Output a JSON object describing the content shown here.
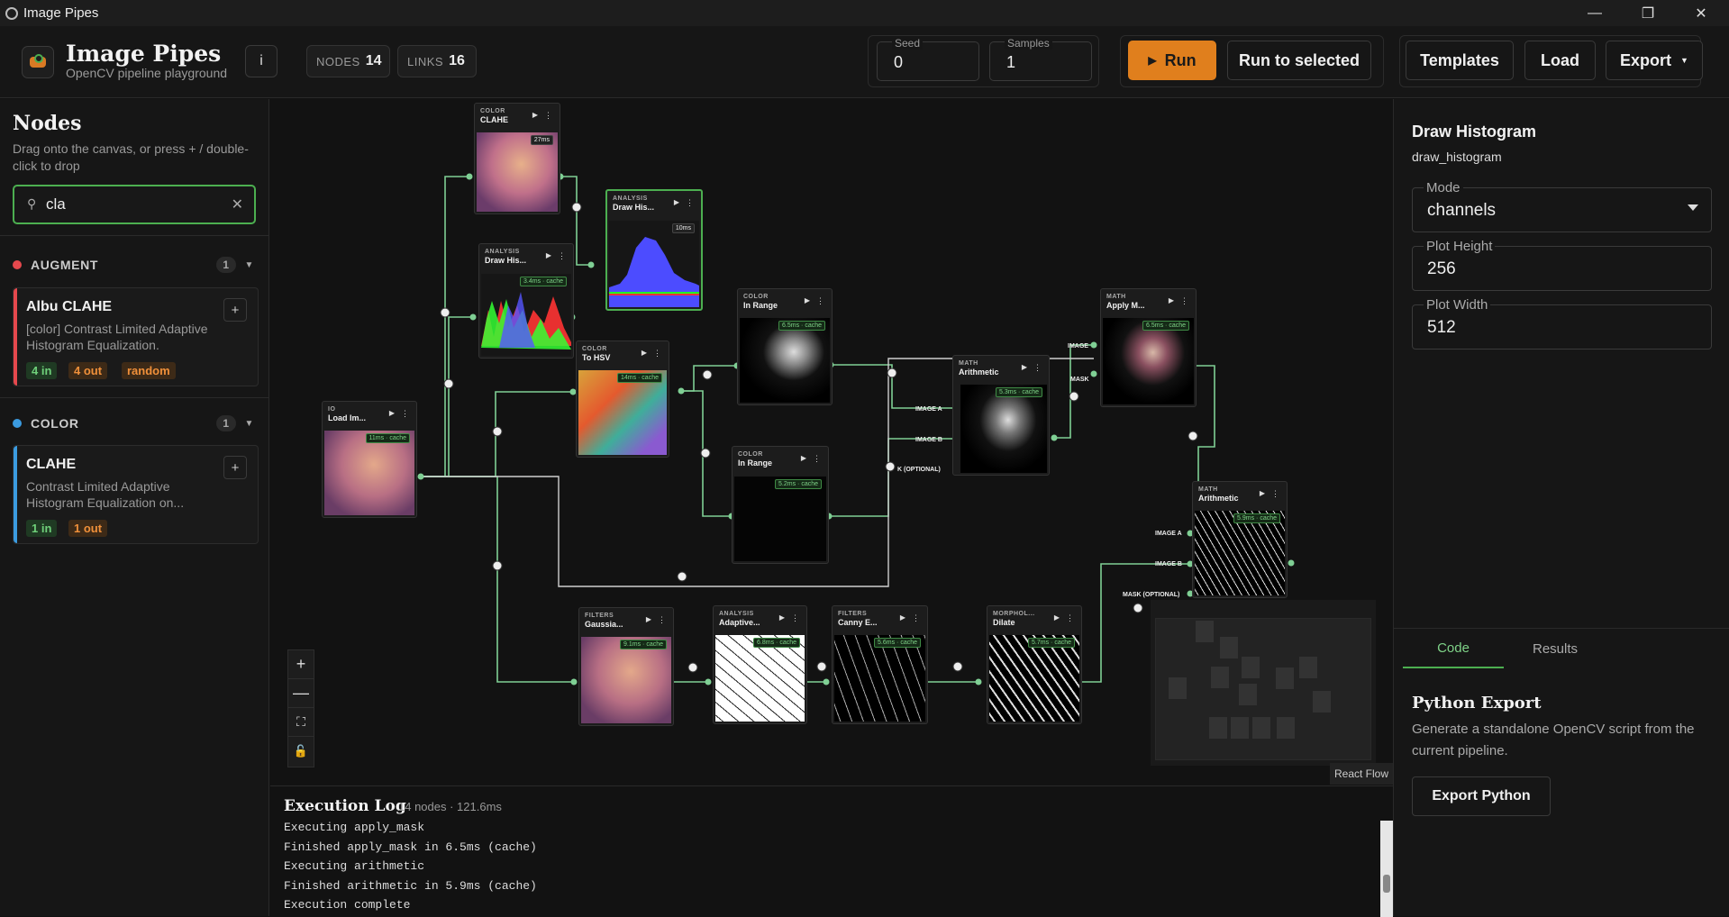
{
  "window": {
    "title": "Image Pipes",
    "min_icon": "minimize-icon",
    "max_icon": "maximize-icon",
    "close_icon": "close-icon"
  },
  "header": {
    "title": "Image Pipes",
    "subtitle": "OpenCV pipeline playground",
    "info_label": "i",
    "nodes_label": "NODES",
    "nodes_count": "14",
    "links_label": "LINKS",
    "links_count": "16",
    "seed_label": "Seed",
    "seed_value": "0",
    "samples_label": "Samples",
    "samples_value": "1",
    "run_label": "Run",
    "run_selected_label": "Run to selected",
    "templates_label": "Templates",
    "load_label": "Load",
    "export_label": "Export"
  },
  "sidebar": {
    "title": "Nodes",
    "hint": "Drag onto the canvas, or press + / double-click to drop",
    "search_value": "cla",
    "categories": [
      {
        "name": "AUGMENT",
        "count": "1",
        "color": "#e5484d",
        "item": {
          "title": "Albu CLAHE",
          "desc": "[color] Contrast Limited Adaptive Histogram Equalization.",
          "tags": [
            "4 in",
            "4 out",
            "random"
          ]
        }
      },
      {
        "name": "COLOR",
        "count": "1",
        "color": "#3b9be0",
        "item": {
          "title": "CLAHE",
          "desc": "Contrast Limited Adaptive Histogram Equalization on...",
          "tags": [
            "1 in",
            "1 out"
          ]
        }
      }
    ]
  },
  "nodes": {
    "clahe": {
      "cat": "COLOR",
      "name": "CLAHE",
      "badge": "27ms"
    },
    "drawhist1": {
      "cat": "ANALYSIS",
      "name": "Draw His...",
      "badge": "10ms"
    },
    "drawhist2": {
      "cat": "ANALYSIS",
      "name": "Draw His...",
      "badge": "3.4ms · cache"
    },
    "tohsv": {
      "cat": "COLOR",
      "name": "To HSV",
      "badge": "14ms · cache"
    },
    "inrange1": {
      "cat": "COLOR",
      "name": "In Range",
      "badge": "6.5ms · cache"
    },
    "inrange2": {
      "cat": "COLOR",
      "name": "In Range",
      "badge": "5.2ms · cache"
    },
    "loadimg": {
      "cat": "IO",
      "name": "Load Im...",
      "badge": "11ms · cache"
    },
    "arith1": {
      "cat": "MATH",
      "name": "Arithmetic",
      "badge": "5.3ms · cache"
    },
    "applymask": {
      "cat": "MATH",
      "name": "Apply M...",
      "badge": "6.5ms · cache"
    },
    "arith2": {
      "cat": "MATH",
      "name": "Arithmetic",
      "badge": "5.9ms · cache"
    },
    "gauss": {
      "cat": "FILTERS",
      "name": "Gaussia...",
      "badge": "9.1ms · cache"
    },
    "adaptive": {
      "cat": "ANALYSIS",
      "name": "Adaptive...",
      "badge": "6.8ms · cache"
    },
    "canny": {
      "cat": "FILTERS",
      "name": "Canny E...",
      "badge": "5.6ms · cache"
    },
    "dilate": {
      "cat": "MORPHOL...",
      "name": "Dilate",
      "badge": "5.7ms · cache"
    }
  },
  "ports": {
    "image": "IMAGE",
    "mask": "MASK",
    "image_a": "IMAGE A",
    "image_b": "IMAGE B",
    "mask_optional": "MASK (OPTIONAL)",
    "k_optional": "K (OPTIONAL)"
  },
  "canvas": {
    "attribution": "React Flow"
  },
  "log": {
    "title": "Execution Log",
    "meta": "14 nodes · 121.6ms",
    "lines": [
      "Executing apply_mask",
      "Finished apply_mask in 6.5ms (cache)",
      "Executing arithmetic",
      "Finished arithmetic in 5.9ms (cache)",
      "Execution complete"
    ]
  },
  "inspector": {
    "title": "Draw Histogram",
    "key": "draw_histogram",
    "mode_label": "Mode",
    "mode_value": "channels",
    "height_label": "Plot Height",
    "height_value": "256",
    "width_label": "Plot Width",
    "width_value": "512",
    "tab_code": "Code",
    "tab_results": "Results",
    "export_title": "Python Export",
    "export_desc": "Generate a standalone OpenCV script from the current pipeline.",
    "export_button": "Export Python"
  },
  "colors": {
    "accent": "#e07f1d",
    "green": "#4caf50",
    "edge": "#7fcf94"
  }
}
